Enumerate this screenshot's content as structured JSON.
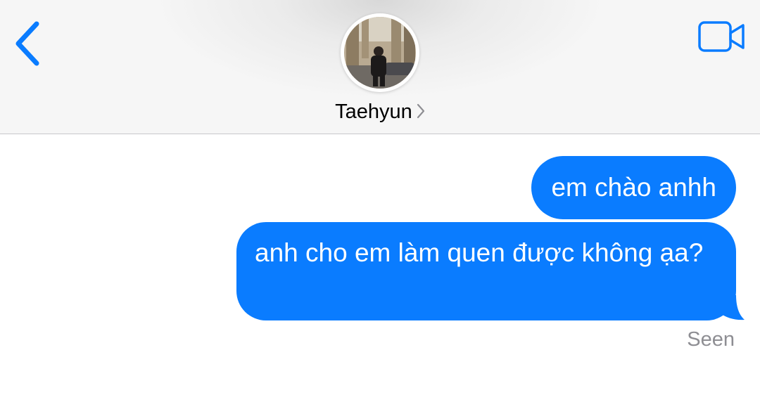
{
  "header": {
    "back_icon": "chevron-left-icon",
    "video_icon": "video-camera-icon",
    "contact_name": "Taehyun",
    "contact_chevron_icon": "chevron-right-icon",
    "avatar": "contact-photo"
  },
  "messages": [
    {
      "sender": "me",
      "text": "em chào anhh"
    },
    {
      "sender": "me",
      "text": "anh cho em làm quen được không ạa?"
    }
  ],
  "status": {
    "label": "Seen"
  },
  "colors": {
    "accent": "#0a7cff",
    "bubble_text": "#ffffff",
    "status_text": "#8e8e93"
  }
}
